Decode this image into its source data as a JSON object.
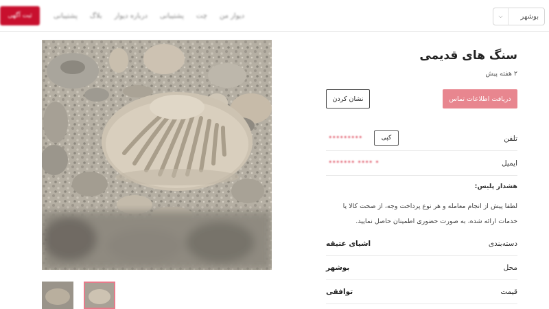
{
  "header": {
    "post_button_label": "ثبت آگهی",
    "nav_items": [
      "دیوار من",
      "چت",
      "پشتیبانی",
      "درباره دیوار",
      "بلاگ",
      "پشتیبانی"
    ],
    "city": "بوشهر"
  },
  "ad": {
    "title": "سنگ های قدیمی",
    "posted": "۲ هفته پیش",
    "contact_button": "دریافت اطلاعات تماس",
    "bookmark_button": "نشان کردن",
    "phone_label": "تلفن",
    "copy_button": "کپی",
    "phone_masked": "*********",
    "email_label": "ایمیل",
    "email_masked": "*******   ****    *",
    "police_title": "هشدار پلیس:",
    "police_text": "لطفا پیش از انجام معامله و هر نوع پرداخت وجه، از صحت کالا یا خدمات ارائه شده، به صورت حضوری اطمینان حاصل نمایید.",
    "info": [
      {
        "label": "دسته‌بندی",
        "value": "اشیای عتیقه"
      },
      {
        "label": "محل",
        "value": "بوشهر"
      },
      {
        "label": "قیمت",
        "value": "توافقی"
      }
    ]
  }
}
